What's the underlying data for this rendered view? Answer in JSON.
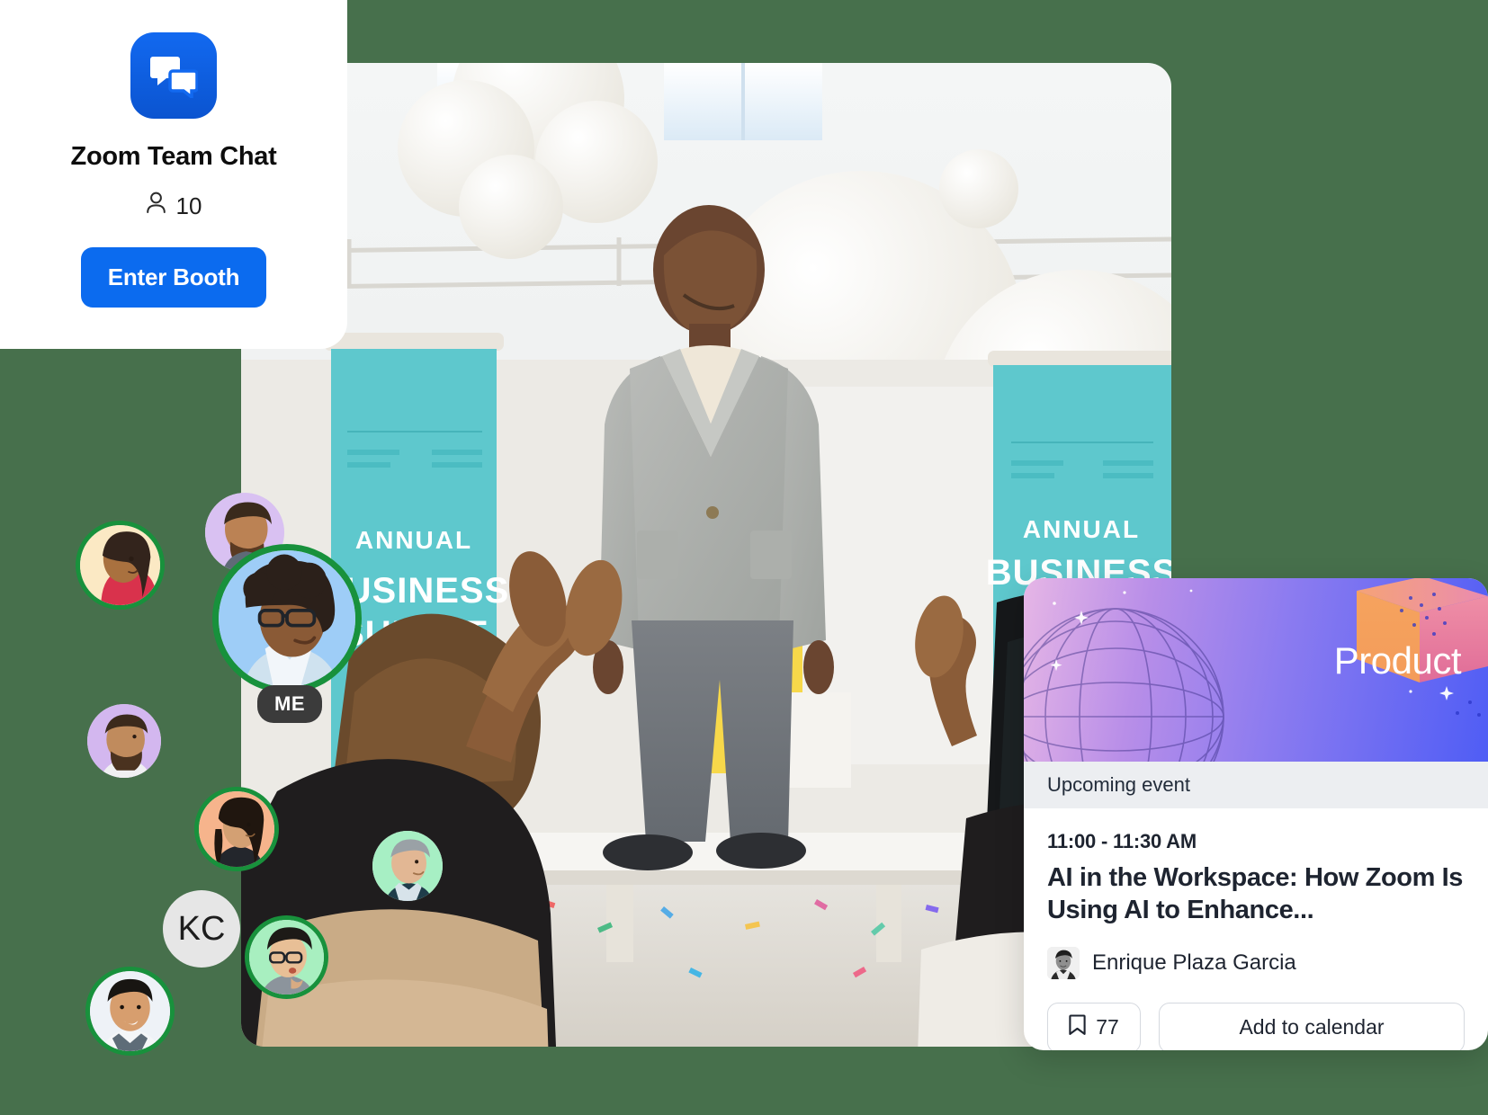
{
  "theme": {
    "page_background": "#47704c",
    "brand_blue": "#0b6bef",
    "presence_green": "#18913c",
    "card_white": "#ffffff",
    "band_grey": "#eceef1",
    "text_dark": "#1e2430"
  },
  "booth_card": {
    "logo_icon": "zoom-team-chat-icon",
    "title": "Zoom Team Chat",
    "people_icon": "person-icon",
    "attendee_count": "10",
    "enter_button_label": "Enter Booth"
  },
  "stage": {
    "photo_alt": "conference-stage-speaker-photo",
    "banner_left_line1": "ANNUAL",
    "banner_left_line2": "BUSINESS",
    "banner_right_line1": "ANNUAL",
    "banner_right_line2": "BUSINESS"
  },
  "participants": [
    {
      "name": "avatar-participant-1",
      "initials": "",
      "bg": "#fbe9c4",
      "active": true
    },
    {
      "name": "avatar-participant-2",
      "initials": "",
      "bg": "#d9c1f2",
      "active": false
    },
    {
      "name": "avatar-self",
      "initials": "",
      "bg": "#9ecdf7",
      "active": true,
      "badge": "ME"
    },
    {
      "name": "avatar-participant-3",
      "initials": "",
      "bg": "#d3b7ef",
      "active": false
    },
    {
      "name": "avatar-participant-4",
      "initials": "",
      "bg": "#f6b48c",
      "active": true
    },
    {
      "name": "avatar-participant-5",
      "initials": "",
      "bg": "#a7efc4",
      "active": false
    },
    {
      "name": "avatar-participant-kc",
      "initials": "KC",
      "bg": "#e6e6e6",
      "active": false
    },
    {
      "name": "avatar-participant-6",
      "initials": "",
      "bg": "#a8efc0",
      "active": true
    },
    {
      "name": "avatar-participant-7",
      "initials": "",
      "bg": "#eef2f7",
      "active": true
    }
  ],
  "self_badge_label": "ME",
  "initials_badge_label": "KC",
  "event_card": {
    "hero_label": "Product",
    "hero_globe_icon": "globe-wireframe-icon",
    "hero_cube_icon": "cube-3d-icon",
    "status_band": "Upcoming event",
    "time": "11:00 - 11:30 AM",
    "title": "AI in the Workspace: How Zoom Is Using AI to Enhance...",
    "speaker_name": "Enrique Plaza Garcia",
    "speaker_avatar_icon": "speaker-portrait-icon",
    "bookmark_icon": "bookmark-icon",
    "bookmark_count": "77",
    "add_to_calendar_label": "Add to calendar"
  }
}
